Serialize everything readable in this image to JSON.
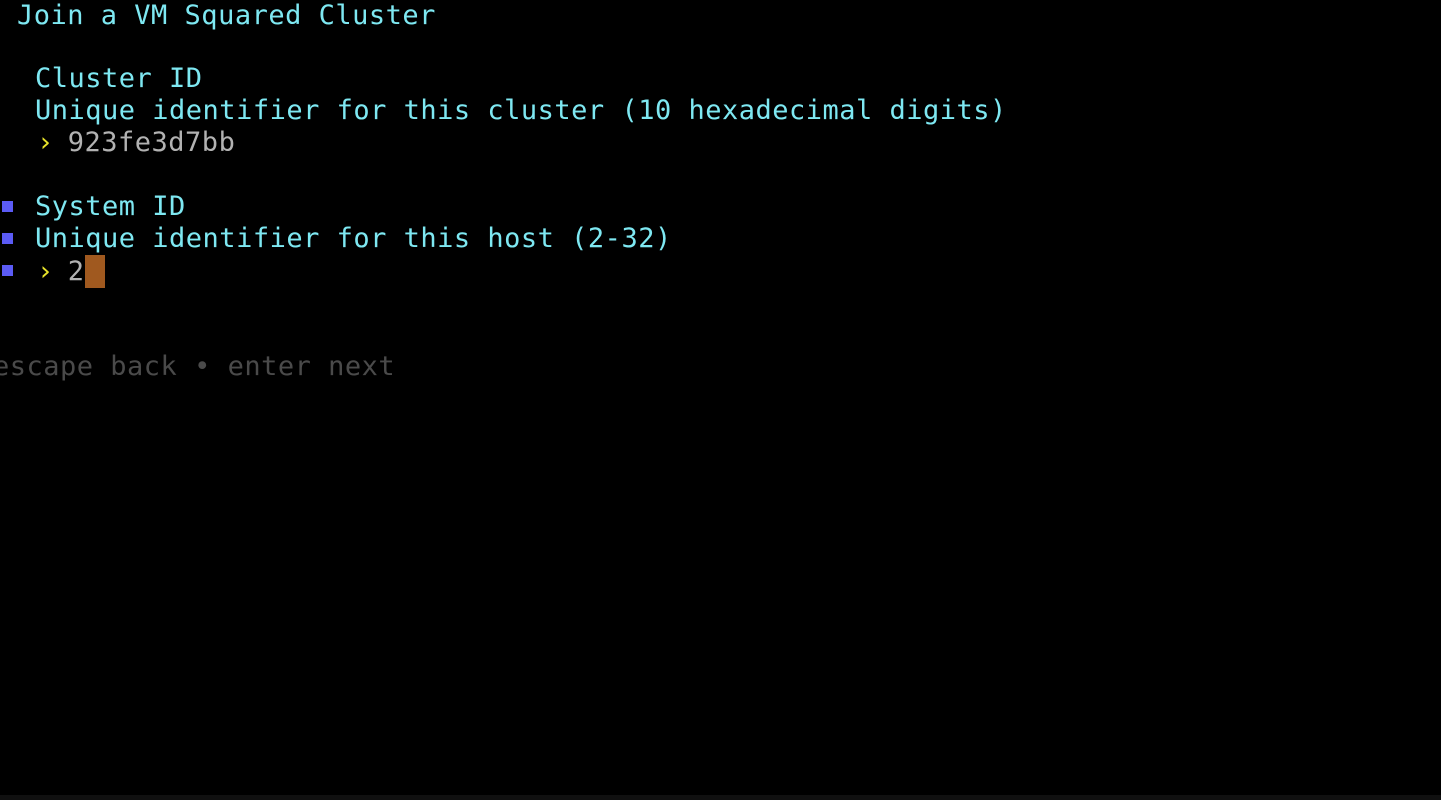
{
  "screen": {
    "title": "Join a VM Squared Cluster",
    "background_color": "#000000"
  },
  "fields": [
    {
      "label": "Cluster ID",
      "description": "Unique identifier for this cluster (10 hexadecimal digits)",
      "prompt": "›",
      "value": "923fe3d7bb",
      "active": false
    },
    {
      "label": "System ID",
      "description": "Unique identifier for this host (2-32)",
      "prompt": "›",
      "value": "2",
      "active": true
    }
  ],
  "footer": {
    "back_key": "escape",
    "back_label": "back",
    "separator": "•",
    "next_key": "enter",
    "next_label": "next",
    "text": "escape back • enter next"
  },
  "colors": {
    "accent_cyan": "#7ee8f2",
    "prompt_yellow": "#e8e32a",
    "value_gray": "#b2b2b2",
    "marker_blue": "#5b5bf5",
    "cursor_orange": "#a0591f",
    "footer_gray": "#4a4a4a"
  }
}
